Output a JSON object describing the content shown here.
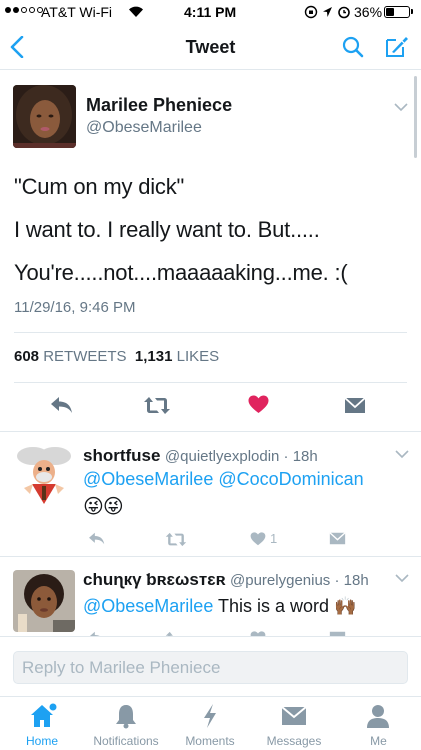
{
  "status_bar": {
    "carrier": "AT&T Wi-Fi",
    "time": "4:11 PM",
    "battery": "36%",
    "battery_level": 0.36
  },
  "nav": {
    "title": "Tweet"
  },
  "main_tweet": {
    "name": "Marilee Pheniece",
    "handle": "@ObeseMarilee",
    "lines": [
      "\"Cum on my dick\"",
      "I want to. I really want to. But.....",
      "You're.....not....maaaaaking...me. :("
    ],
    "timestamp": "11/29/16, 9:46 PM",
    "retweets_count": "608",
    "retweets_label": "RETWEETS",
    "likes_count": "1,131",
    "likes_label": "LIKES",
    "like_color": "#e0245e"
  },
  "replies": [
    {
      "name": "shortfuse",
      "handle_time": "@quietlyexplodin · 18h",
      "mention1": "@ObeseMarilee",
      "mention2": "@CocoDominican",
      "emojis": "😜😜",
      "like_count": "1"
    },
    {
      "name": "chuɳкγ ƅʀɛωsтɛʀ",
      "handle_time": "@purelygenius · 18h",
      "mention1": "@ObeseMarilee",
      "text": "This is a word",
      "emoji": "🙌🏾"
    }
  ],
  "reply_box": {
    "placeholder": "Reply to Marilee Pheniece"
  },
  "tabs": [
    {
      "label": "Home",
      "active": true
    },
    {
      "label": "Notifications"
    },
    {
      "label": "Moments"
    },
    {
      "label": "Messages"
    },
    {
      "label": "Me"
    }
  ],
  "colors": {
    "accent": "#1da1f2",
    "muted": "#657786",
    "border": "#e1e8ed"
  }
}
